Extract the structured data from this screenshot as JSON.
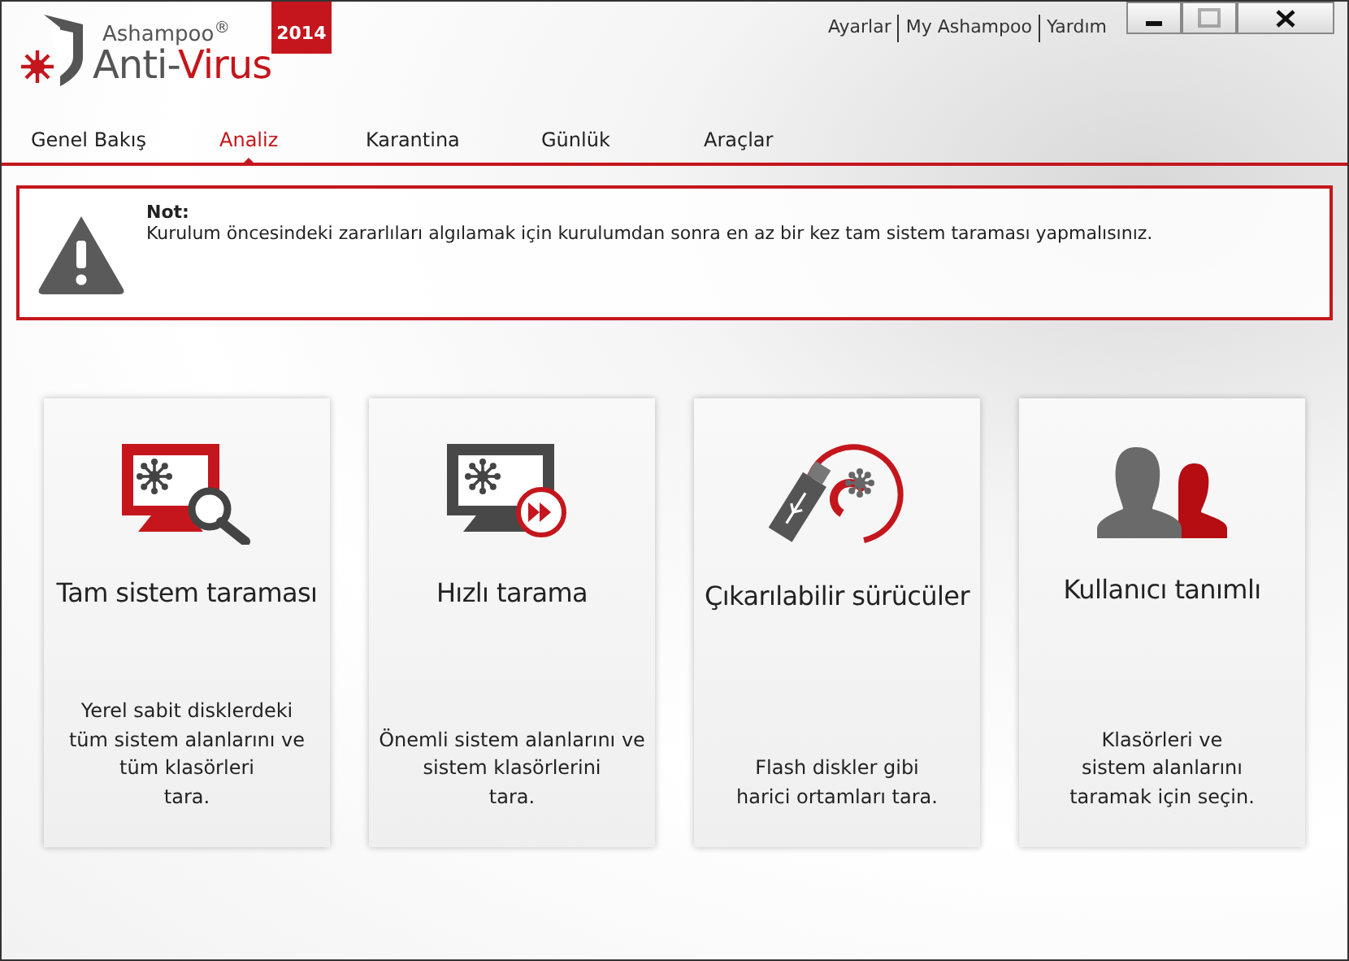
{
  "logo": {
    "brand": "Ashampoo$^{®}$",
    "product": {
      "plain": "Anti-",
      "accent": "Virus"
    },
    "year": "2014"
  },
  "top_links": [
    "Ayarlar",
    "My Ashampoo",
    "Yardım"
  ],
  "window_controls": [
    {
      "kind": "minimize",
      "disabled": false
    },
    {
      "kind": "maximize",
      "disabled": true
    },
    {
      "kind": "close",
      "disabled": false
    }
  ],
  "tabs": [
    {
      "label": "Genel Bakış",
      "selected": false
    },
    {
      "label": "Analiz",
      "selected": true
    },
    {
      "label": "Karantina",
      "selected": false
    },
    {
      "label": "Günlük",
      "selected": false
    },
    {
      "label": "Araçlar",
      "selected": false
    }
  ],
  "notice": {
    "title": "Not:",
    "text": "Kurulum öncesindeki zararlıları algılamak için kurulumdan sonra en az bir kez tam sistem taraması yapmalısınız."
  },
  "scan_options": [
    {
      "kind": "full",
      "title": "Tam sistem taraması",
      "description": "Yerel sabit disklerdeki\ntüm sistem alanlarını ve\ntüm klasörleri\ntara."
    },
    {
      "kind": "quick",
      "title": "Hızlı tarama",
      "description": "Önemli sistem alanlarını ve\nsistem klasörlerini\ntara."
    },
    {
      "kind": "removable",
      "title": "Çıkarılabilir sürücüler",
      "description": "Flash diskler gibi\nharici ortamları tara."
    },
    {
      "kind": "custom",
      "title": "Kullanıcı tanımlı",
      "description": "Klasörleri ve\nsistem alanlarını\ntaramak için seçin."
    }
  ]
}
